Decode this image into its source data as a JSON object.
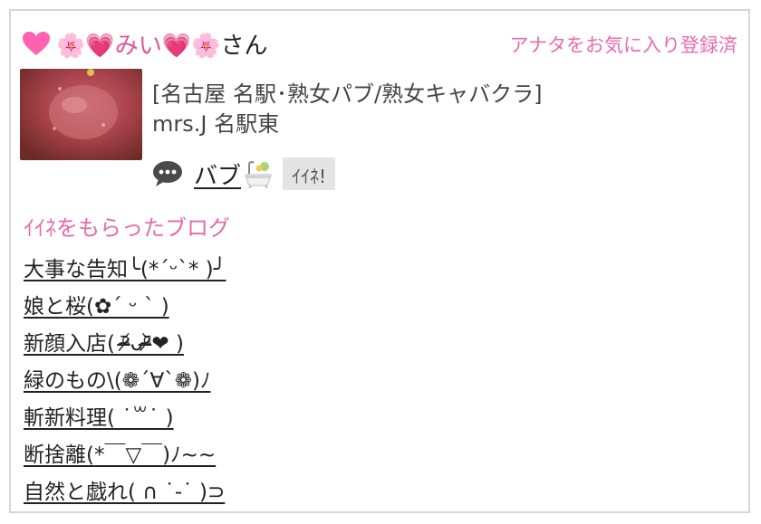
{
  "header": {
    "username_prefix_emoji": "🌸💗",
    "username_name": "みい",
    "username_suffix_emoji": "💗🌸",
    "username_honorific": "さん",
    "favorite_status": "アナタをお気に入り登録済"
  },
  "shop": {
    "category": "[名古屋 名駅･熟女パブ/熟女キャバクラ]",
    "name": "mrs.J 名駅東"
  },
  "post": {
    "title": "バブ",
    "like_label": "ｲｲﾈ!"
  },
  "liked_blogs": {
    "heading": "ｲｲﾈをもらったブログ",
    "items": [
      "大事な告知╰(*ˊᵕˋ* )╯",
      "娘と桜(✿ˊ ᵕ ˋ )",
      "新顔入店( ᵒ̴̶̷᷄ᴗᵒ̴̶̷᷅❤ )",
      "緑のもの\\(❁´∀`❁)ﾉ",
      "斬新料理( ˙꒳˙ )",
      "断捨離(*￣▽￣)ﾉ~~",
      "自然と戯れ( ∩ ˙-˙ )⊃"
    ]
  },
  "colors": {
    "accent_pink": "#e66aa9",
    "heart_pink": "#ff62b0",
    "border": "#d6d6d6",
    "like_bg": "#e4e4e4"
  }
}
